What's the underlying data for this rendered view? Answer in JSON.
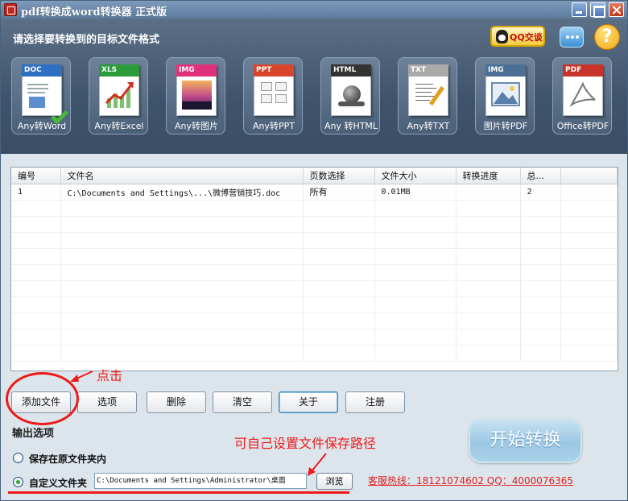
{
  "window": {
    "title": "pdf转换成word转换器 正式版"
  },
  "header": {
    "prompt": "请选择要转换到的目标文件格式",
    "qq_label": "QQ交谈",
    "help_label": "?",
    "formats": [
      {
        "tag": "DOC",
        "label": "Any转Word",
        "color": "#2f6fc2"
      },
      {
        "tag": "XLS",
        "label": "Any转Excel",
        "color": "#2c9b3c"
      },
      {
        "tag": "IMG",
        "label": "Any转图片",
        "color": "#e0327a"
      },
      {
        "tag": "PPT",
        "label": "Any转PPT",
        "color": "#d8452a"
      },
      {
        "tag": "HTML",
        "label": "Any 转HTML",
        "color": "#333333"
      },
      {
        "tag": "TXT",
        "label": "Any转TXT",
        "color": "#aaaaaa"
      },
      {
        "tag": "IMG",
        "label": "图片转PDF",
        "color": "#4c6f95"
      },
      {
        "tag": "PDF",
        "label": "Office转PDF",
        "color": "#c8342a"
      }
    ]
  },
  "table": {
    "columns": [
      "编号",
      "文件名",
      "页数选择",
      "文件大小",
      "转换进度",
      "总..."
    ],
    "rows": [
      [
        "1",
        "C:\\Documents and Settings\\...\\微博营销技巧.doc",
        "所有",
        "0.01MB",
        "",
        "2"
      ]
    ]
  },
  "buttons": {
    "add": "添加文件",
    "options": "选项",
    "delete": "删除",
    "clear": "清空",
    "about": "关于",
    "register": "注册"
  },
  "output": {
    "title": "输出选项",
    "option_original": "保存在原文件夹内",
    "option_custom": "自定义文件夹",
    "path_value": "C:\\Documents and Settings\\Administrator\\桌面",
    "browse": "浏览",
    "selected": "custom"
  },
  "start_button": "开始转换",
  "hotline": "客服热线：18121074602 QQ：4000076365",
  "annotations": {
    "click_hint": "点击",
    "path_hint": "可自己设置文件保存路径",
    "color": "#ee1a1a"
  }
}
